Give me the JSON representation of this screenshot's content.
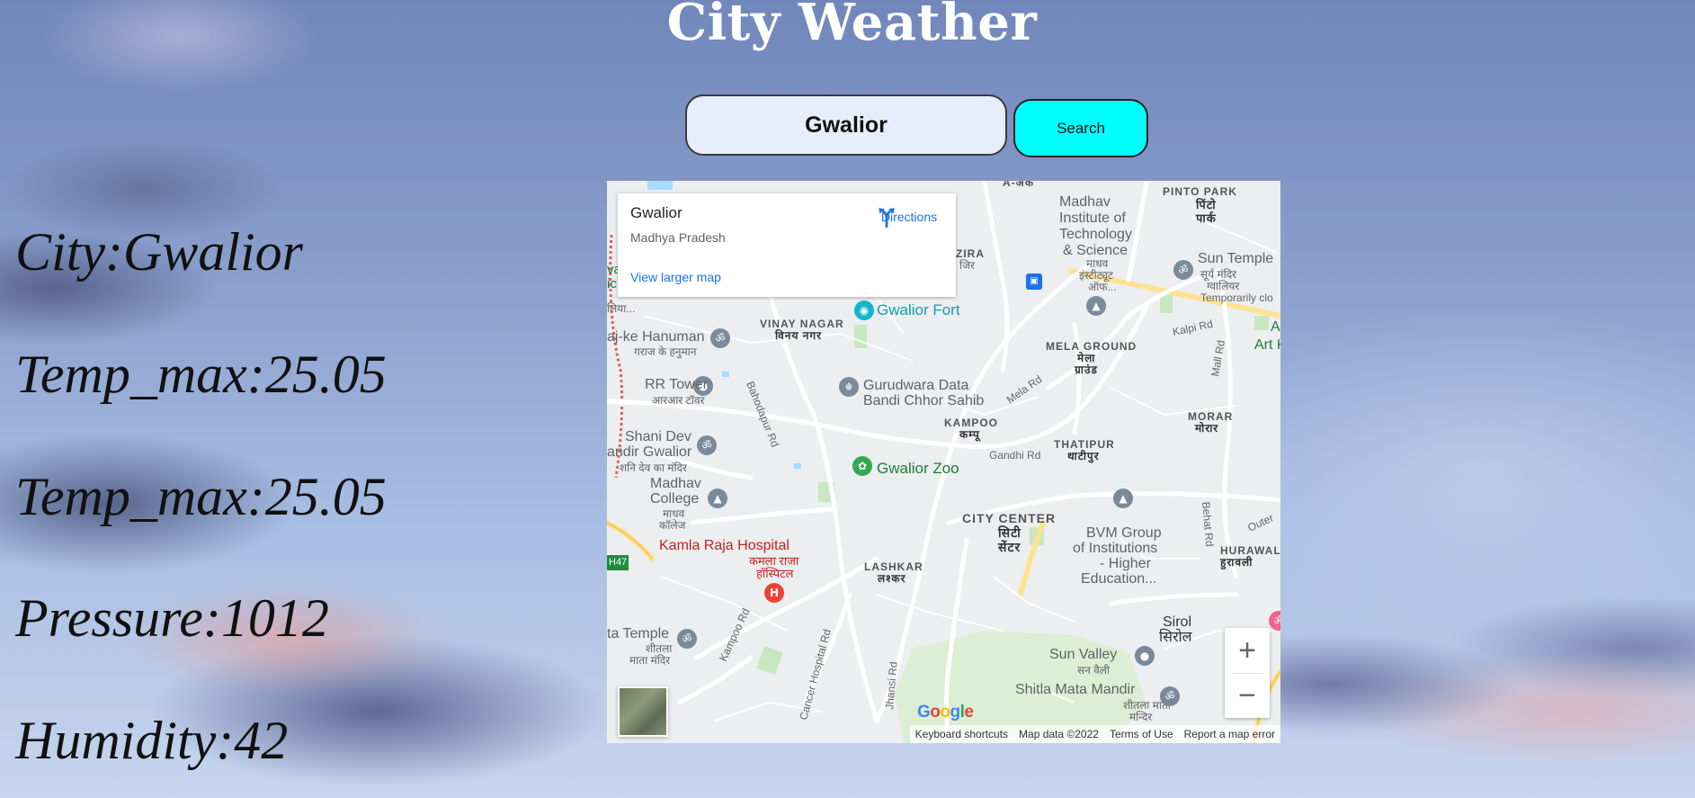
{
  "page": {
    "title": "City Weather"
  },
  "search": {
    "value": "Gwalior",
    "button_label": "Search"
  },
  "info": {
    "city": "City:Gwalior",
    "temp_max_1": "Temp_max:25.05",
    "temp_max_2": "Temp_max:25.05",
    "pressure": "Pressure:1012",
    "humidity": "Humidity:42"
  },
  "map": {
    "card": {
      "title": "Gwalior",
      "subtitle": "Madhya Pradesh",
      "larger_map_link": "View larger map",
      "directions_label": "Directions"
    },
    "pois": {
      "gwalior_fort": "Gwalior Fort",
      "gwalior_zoo": "Gwalior Zoo",
      "gurudwara_1": "Gurudwara Data",
      "gurudwara_2": "Bandi Chhor Sahib",
      "kamla_raja_1": "Kamla Raja Hospital",
      "kamla_raja_2": "कमला राजा",
      "kamla_raja_3": "हॉस्पिटल",
      "madhav_inst_1": "Madhav",
      "madhav_inst_2": "Institute of",
      "madhav_inst_3": "Technology",
      "madhav_inst_4": "& Science",
      "madhav_inst_hi_1": "माधव",
      "madhav_inst_hi_2": "इंस्टीट्यूट",
      "madhav_inst_hi_3": "ऑफ...",
      "rr_tower": "RR Tower",
      "rr_tower_hi": "आरआर टॉवर",
      "hanuman": "aj-ke Hanuman",
      "hanuman_hi": "गराज के हनुमान",
      "shani_dev_1": "Shani Dev",
      "shani_dev_2": "andir Gwalior",
      "shani_dev_hi": "शनि देव का मंदिर",
      "madhav_college_1": "Madhav",
      "madhav_college_2": "College",
      "madhav_college_hi_1": "माधव",
      "madhav_college_hi_2": "कॉलेज",
      "sun_temple_1": "Sun Temple",
      "sun_temple_2": "सूर्य मंदिर",
      "sun_temple_3": "ग्वालियर",
      "sun_temple_4": "Temporarily clo",
      "bvm_1": "BVM Group",
      "bvm_2": "of Institutions",
      "bvm_3": "- Higher",
      "bvm_4": "Education...",
      "sun_valley_1": "Sun Valley",
      "sun_valley_2": "सन वैली",
      "shitla_1": "Shitla Mata Mandir",
      "shitla_2": "शीतला माता",
      "shitla_3": "मन्दिर",
      "sirol_1": "Sirol",
      "sirol_2": "सिरोल",
      "ta_temple_1": "ta Temple",
      "ta_temple_2": "शीतला",
      "ta_temple_3": "माता मंदिर",
      "art_1": "A",
      "art_2": "Art K",
      "vic": "va",
      "vic2": "ic",
      "vic3": "लिया...",
      "zira": "ZIRA",
      "zira_hi": "जिर"
    },
    "areas": {
      "pinto_park": "PINTO PARK",
      "pinto_park_hi_1": "पिंटो",
      "pinto_park_hi_2": "पार्क",
      "vinay_nagar": "VINAY NAGAR",
      "vinay_nagar_hi": "विनय नगर",
      "mela_ground": "MELA GROUND",
      "mela_ground_hi_1": "मेला",
      "mela_ground_hi_2": "ग्राउंड",
      "kampoo": "KAMPOO",
      "kampoo_hi": "कम्पू",
      "thatipur": "THATIPUR",
      "thatipur_hi": "थाटीपुर",
      "morar": "MORAR",
      "morar_hi": "मोरार",
      "city_center": "CITY CENTER",
      "city_center_hi_1": "सिटी",
      "city_center_hi_2": "सेंटर",
      "lashkar": "LASHKAR",
      "lashkar_hi": "लश्कर",
      "hurawali": "HURAWALI",
      "hurawali_hi": "हुरावली",
      "top_cut": "A-अक",
      "h47": "H47"
    },
    "roads": {
      "kalpi": "Kalpi Rd",
      "mall": "Mall Rd",
      "mela": "Mela Rd",
      "gandhi": "Gandhi Rd",
      "behat": "Behat Rd",
      "bahodapur": "Bahodapur Rd",
      "kampoo": "Kampoo Rd",
      "cancer": "Cancer Hospital Rd",
      "jhansi": "Jhansi Rd",
      "outer": "Outer"
    },
    "zoom_in": "+",
    "zoom_out": "−",
    "google_logo": "Google",
    "attribution": {
      "shortcuts": "Keyboard shortcuts",
      "data": "Map data ©2022",
      "terms": "Terms of Use",
      "report": "Report a map error"
    },
    "colors": {
      "fort_pin": "#12b5cb",
      "zoo_pin": "#34a853",
      "hospital_pin": "#ea4335",
      "gray_pin": "#7b8a99",
      "park_green": "#c7e7c0",
      "poi_teal": "#12b5cb",
      "poi_green": "#188038",
      "poi_red": "#c5221f"
    }
  }
}
